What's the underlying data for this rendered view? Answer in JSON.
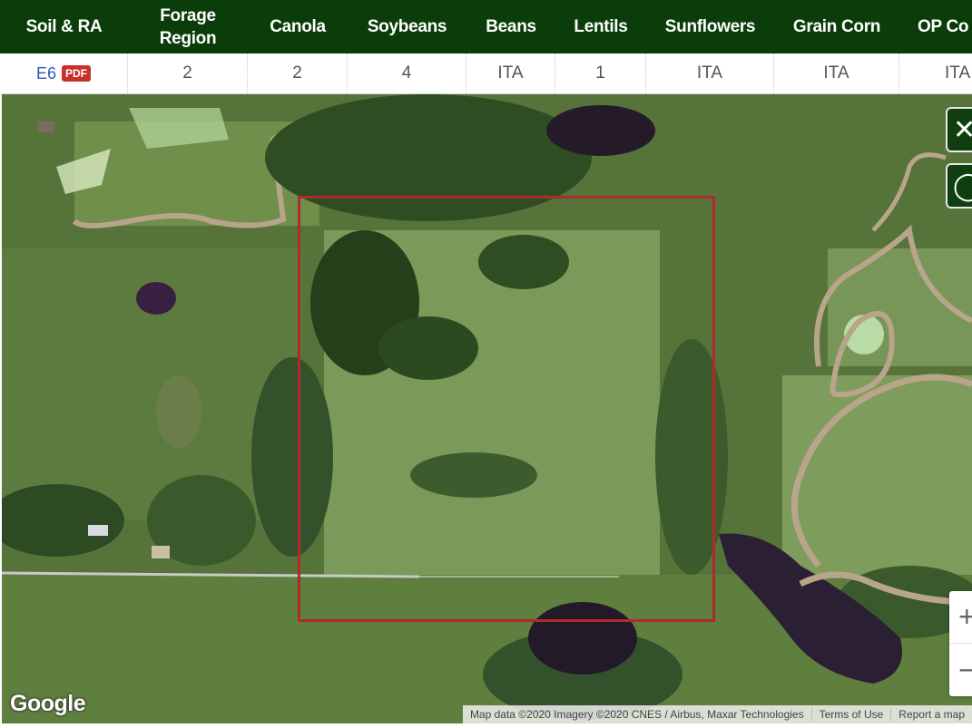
{
  "header": {
    "columns": [
      "Soil & RA",
      "Forage\nRegion",
      "Canola",
      "Soybeans",
      "Beans",
      "Lentils",
      "Sunflowers",
      "Grain Corn",
      "OP Co"
    ]
  },
  "row": {
    "soil_link": "E6",
    "pdf_badge": "PDF",
    "forage_region": "2",
    "canola": "2",
    "soybeans": "4",
    "beans": "ITA",
    "lentils": "1",
    "sunflowers": "ITA",
    "grain_corn": "ITA",
    "op_corn": "ITA"
  },
  "map": {
    "controls": {
      "close_icon": "close-icon",
      "search_icon": "search-icon",
      "zoom_in_label": "+",
      "zoom_out_label": "−"
    },
    "logo": "Google",
    "attribution": {
      "data": "Map data ©2020 Imagery ©2020 CNES / Airbus, Maxar Technologies",
      "terms": "Terms of Use",
      "report": "Report a map"
    }
  },
  "colors": {
    "header_bg": "#0b3d0b",
    "parcel_border": "#b02a2a",
    "pdf_badge": "#c9302c",
    "link": "#2a5db0"
  }
}
